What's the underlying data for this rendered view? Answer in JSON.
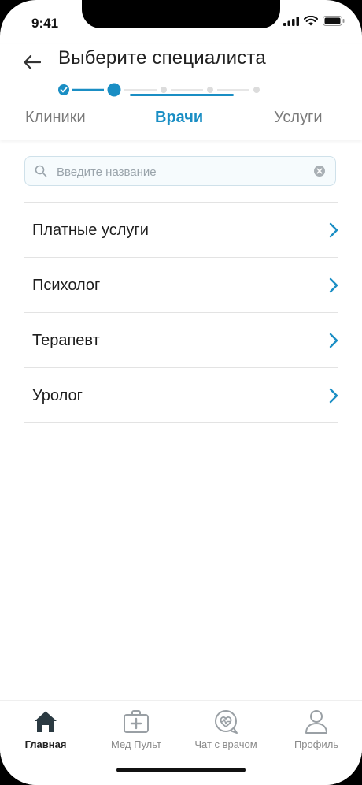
{
  "status_bar": {
    "time": "9:41"
  },
  "header": {
    "title": "Выберите специалиста",
    "back_icon": "arrow-left-icon"
  },
  "stepper": {
    "total_steps": 5,
    "completed_steps": 1,
    "current_step": 2
  },
  "tabs": [
    {
      "label": "Клиники",
      "active": false
    },
    {
      "label": "Врачи",
      "active": true
    },
    {
      "label": "Услуги",
      "active": false
    }
  ],
  "search": {
    "placeholder": "Введите название",
    "value": ""
  },
  "list": {
    "items": [
      {
        "label": "Платные услуги"
      },
      {
        "label": "Психолог"
      },
      {
        "label": "Терапевт"
      },
      {
        "label": "Уролог"
      }
    ]
  },
  "bottom_nav": {
    "items": [
      {
        "label": "Главная",
        "icon": "home-icon",
        "active": true
      },
      {
        "label": "Мед Пульт",
        "icon": "medical-kit-icon",
        "active": false
      },
      {
        "label": "Чат с врачом",
        "icon": "heart-chat-icon",
        "active": false
      },
      {
        "label": "Профиль",
        "icon": "user-icon",
        "active": false
      }
    ]
  },
  "colors": {
    "accent": "#1a8ec4",
    "inactive_text": "#7a7a7a",
    "divider": "#e3e3e3"
  }
}
